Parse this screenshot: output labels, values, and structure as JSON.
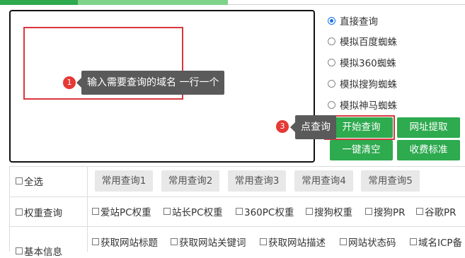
{
  "annotations": {
    "step1": {
      "number": "1",
      "text": "输入需要查询的域名 一行一个"
    },
    "step3": {
      "number": "3",
      "text": "点查询"
    }
  },
  "modes": [
    {
      "label": "直接查询",
      "selected": true
    },
    {
      "label": "模拟百度蜘蛛",
      "selected": false
    },
    {
      "label": "模拟360蜘蛛",
      "selected": false
    },
    {
      "label": "模拟搜狗蜘蛛",
      "selected": false
    },
    {
      "label": "模拟神马蜘蛛",
      "selected": false
    }
  ],
  "buttons": {
    "start": "开始查询",
    "extract": "网址提取",
    "clear": "一键清空",
    "pricing": "收费标准"
  },
  "rows": {
    "select_all": "全选",
    "weight_query": "权重查询",
    "basic_info": "基本信息"
  },
  "common_queries": [
    "常用查询1",
    "常用查询2",
    "常用查询3",
    "常用查询4",
    "常用查询5"
  ],
  "weight_options": [
    "爱站PC权重",
    "站长PC权重",
    "360PC权重",
    "搜狗权重",
    "搜狗PR",
    "谷歌PR"
  ],
  "basic_options": [
    "获取网站标题",
    "获取网站关键词",
    "获取网站描述",
    "网站状态码",
    "域名ICP备"
  ],
  "colors": {
    "accent": "#2eaa4f",
    "highlight": "#d9363e",
    "badge": "#e53935",
    "tooltip": "#5a5a5a"
  }
}
